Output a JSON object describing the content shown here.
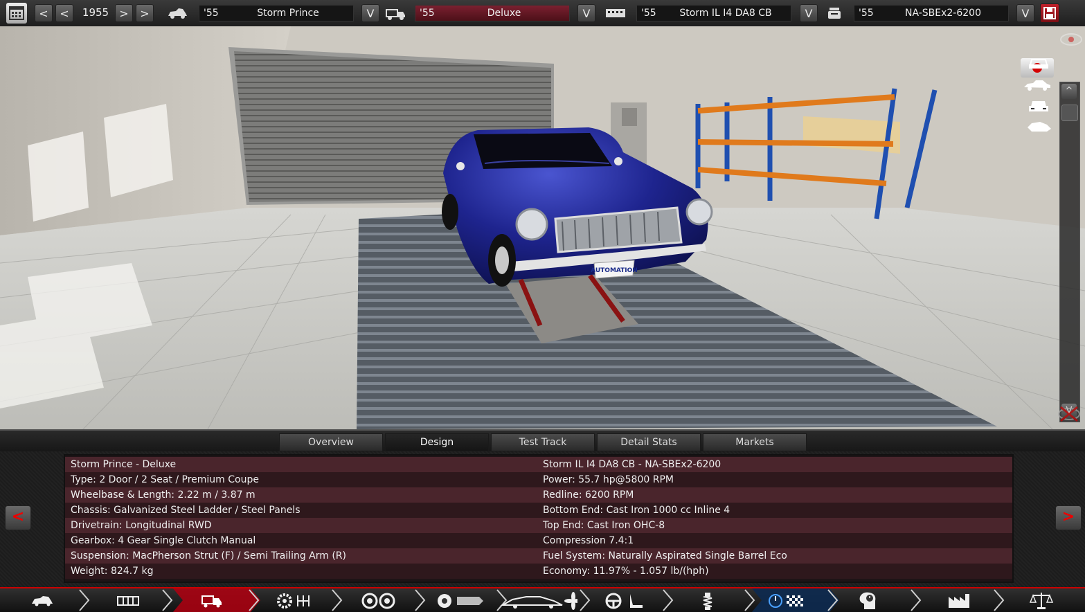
{
  "topbar": {
    "year": "1955",
    "model": {
      "year": "'55",
      "name": "Storm Prince"
    },
    "trim": {
      "year": "'55",
      "name": "Deluxe"
    },
    "engine_family": {
      "year": "'55",
      "name": "Storm IL I4 DA8 CB"
    },
    "engine_variant": {
      "year": "'55",
      "name": "NA-SBEx2-6200"
    },
    "prev_label": "<",
    "next_label": ">",
    "dropdown_label": "V"
  },
  "scene": {
    "license_plate": "AUTOMATION",
    "scroll_up_label": "^",
    "scroll_down_label": "V"
  },
  "tabs": [
    {
      "label": "Overview"
    },
    {
      "label": "Design"
    },
    {
      "label": "Test Track"
    },
    {
      "label": "Detail Stats"
    },
    {
      "label": "Markets"
    }
  ],
  "active_tab": "Design",
  "info": {
    "left": [
      "Storm Prince - Deluxe",
      "Type: 2 Door / 2 Seat / Premium Coupe",
      "Wheelbase & Length: 2.22 m / 3.87 m",
      "Chassis: Galvanized Steel Ladder / Steel Panels",
      "Drivetrain: Longitudinal RWD",
      "Gearbox: 4 Gear Single Clutch Manual",
      "Suspension: MacPherson Strut (F) / Semi Trailing Arm (R)",
      "Weight: 824.7 kg"
    ],
    "right": [
      "Storm IL I4 DA8 CB - NA-SBEx2-6200",
      "Power: 55.7 hp@5800 RPM",
      "Redline: 6200 RPM",
      "Bottom End: Cast Iron 1000 cc Inline 4",
      "Top End: Cast Iron OHC-8",
      "Compression 7.4:1",
      "Fuel System: Naturally Aspirated Single Barrel Eco",
      "Economy: 11.97% - 1.057 lb/(hph)"
    ],
    "prev_label": "<",
    "next_label": ">"
  },
  "colors": {
    "accent_red": "#c00000",
    "row_odd": "#4a252c",
    "row_even": "#2e181c",
    "car_body": "#1c1f8a",
    "shelf_blue": "#1f4fb0",
    "shelf_orange": "#e07a1c"
  },
  "bottom_nav": [
    {
      "icon": "car-model-icon"
    },
    {
      "icon": "chassis-icon"
    },
    {
      "icon": "trim-icon",
      "active": true
    },
    {
      "icon": "drivetrain-gear-icon"
    },
    {
      "icon": "wheels-icon"
    },
    {
      "icon": "brakes-icon"
    },
    {
      "icon": "body-aero-icon"
    },
    {
      "icon": "interior-icon"
    },
    {
      "icon": "suspension-icon"
    },
    {
      "icon": "test-track-icon",
      "active": true
    },
    {
      "icon": "engineering-time-icon"
    },
    {
      "icon": "factory-icon"
    },
    {
      "icon": "market-balance-icon"
    }
  ]
}
